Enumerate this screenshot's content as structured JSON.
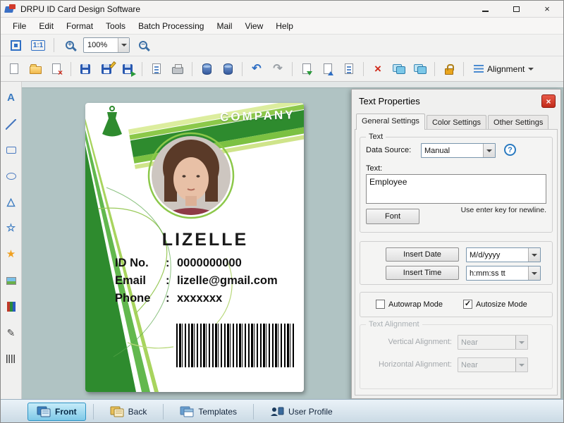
{
  "window": {
    "title": "DRPU ID Card Design Software"
  },
  "menu": {
    "items": [
      "File",
      "Edit",
      "Format",
      "Tools",
      "Batch Processing",
      "Mail",
      "View",
      "Help"
    ]
  },
  "zoom_toolbar": {
    "actual_size_label": "1:1",
    "zoom_level": "100%"
  },
  "main_toolbar": {
    "alignment_label": "Alignment"
  },
  "tool_glyphs": {
    "text_tool": "A",
    "triangle_tool": "△",
    "star_tool": "☆",
    "custom_shape_tool": "★",
    "signature_tool": "✎"
  },
  "arrow_glyphs": {
    "undo": "↶",
    "redo": "↷",
    "delete": "×",
    "close_window": "×"
  },
  "card": {
    "company_text": "COMPANY",
    "name": "LIZELLE",
    "fields": [
      {
        "label": "ID No.",
        "separator": ":",
        "value": "0000000000"
      },
      {
        "label": "Email",
        "separator": ":",
        "value": "lizelle@gmail.com"
      },
      {
        "label": "Phone",
        "separator": ":",
        "value": "xxxxxxx"
      }
    ]
  },
  "panel": {
    "title": "Text Properties",
    "close_label": "×",
    "tabs": [
      "General Settings",
      "Color Settings",
      "Other Settings"
    ],
    "text_group": {
      "legend": "Text",
      "data_source_label": "Data Source:",
      "data_source_value": "Manual",
      "help_glyph": "?",
      "text_label": "Text:",
      "text_value": "Employee",
      "hint": "Use enter key for newline.",
      "font_button": "Font"
    },
    "insert_group": {
      "date_button": "Insert Date",
      "date_format": "M/d/yyyy",
      "time_button": "Insert Time",
      "time_format": "h:mm:ss tt"
    },
    "mode_group": {
      "autowrap_label": "Autowrap Mode",
      "autowrap_checked": false,
      "autosize_label": "Autosize Mode",
      "autosize_checked": true
    },
    "alignment_group": {
      "legend": "Text Alignment",
      "vertical_label": "Vertical Alignment:",
      "vertical_value": "Near",
      "horizontal_label": "Horizontal Alignment:",
      "horizontal_value": "Near",
      "disabled": true
    }
  },
  "bottom_tabs": {
    "front": "Front",
    "back": "Back",
    "templates": "Templates",
    "user_profile": "User Profile"
  },
  "colors": {
    "accent_green": "#2e8b2e",
    "lime_green": "#8cc84a",
    "close_red": "#c12a1a",
    "front_tab_blue": "#7fc9e8",
    "canvas_gray": "#b0c3c3"
  }
}
